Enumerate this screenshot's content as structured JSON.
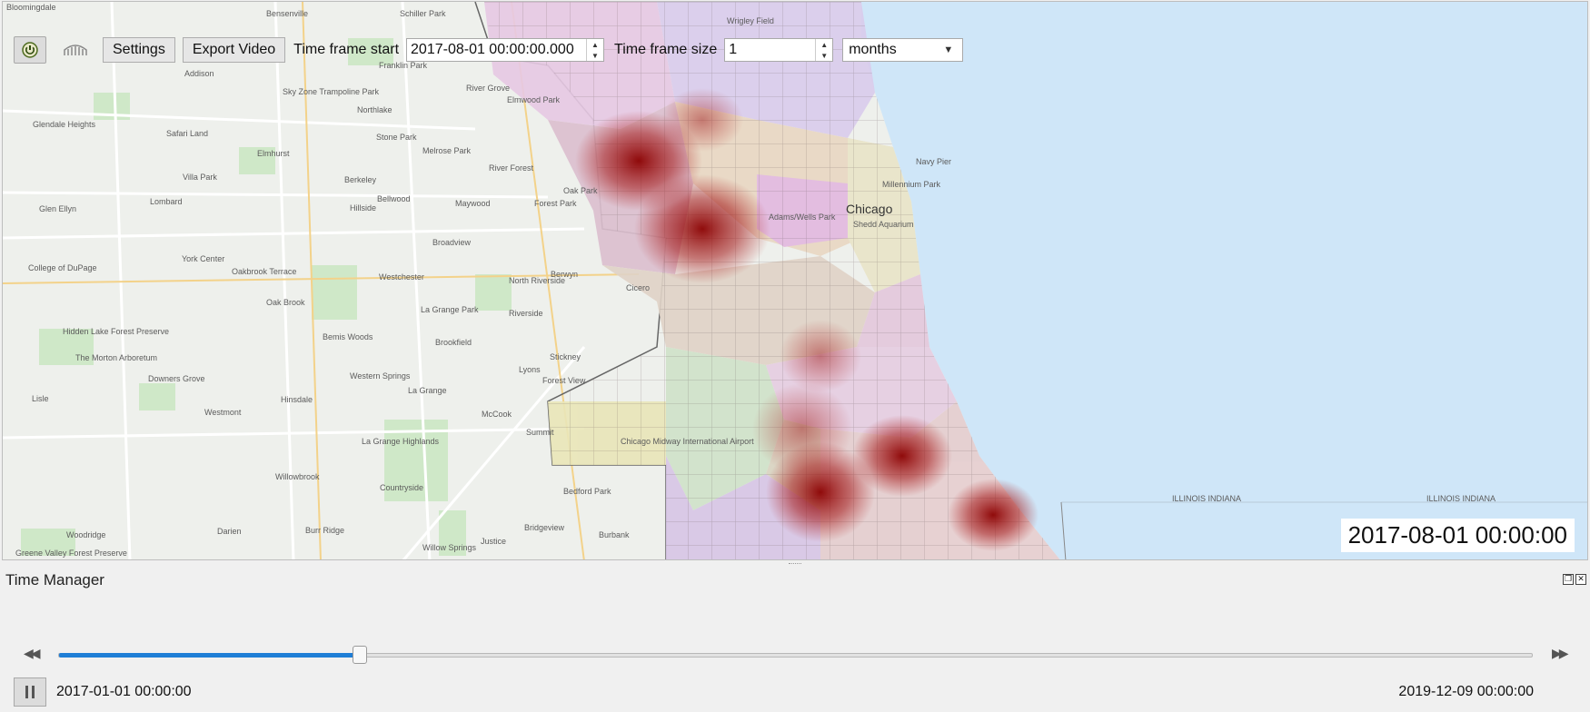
{
  "map": {
    "current_time": "2017-08-01 00:00:00",
    "place_labels": [
      {
        "text": "Bloomingdale"
      },
      {
        "text": "Bensenville"
      },
      {
        "text": "Schiller Park"
      },
      {
        "text": "Franklin Park"
      },
      {
        "text": "Addison"
      },
      {
        "text": "Sky Zone Trampoline Park"
      },
      {
        "text": "River Grove"
      },
      {
        "text": "Elmwood Park"
      },
      {
        "text": "Northlake"
      },
      {
        "text": "Glendale Heights"
      },
      {
        "text": "Safari Land"
      },
      {
        "text": "Stone Park"
      },
      {
        "text": "Melrose Park"
      },
      {
        "text": "Elmhurst"
      },
      {
        "text": "River Forest"
      },
      {
        "text": "Villa Park"
      },
      {
        "text": "Berkeley"
      },
      {
        "text": "Bellwood"
      },
      {
        "text": "Oak Park"
      },
      {
        "text": "Glen Ellyn"
      },
      {
        "text": "Lombard"
      },
      {
        "text": "Hillside"
      },
      {
        "text": "Maywood"
      },
      {
        "text": "Forest Park"
      },
      {
        "text": "Broadview"
      },
      {
        "text": "College of DuPage"
      },
      {
        "text": "York Center"
      },
      {
        "text": "Oakbrook Terrace"
      },
      {
        "text": "Westchester"
      },
      {
        "text": "Berwyn"
      },
      {
        "text": "Cicero"
      },
      {
        "text": "North Riverside"
      },
      {
        "text": "Oak Brook"
      },
      {
        "text": "La Grange Park"
      },
      {
        "text": "Riverside"
      },
      {
        "text": "Hidden Lake Forest Preserve"
      },
      {
        "text": "Bemis Woods"
      },
      {
        "text": "Brookfield"
      },
      {
        "text": "The Morton Arboretum"
      },
      {
        "text": "Downers Grove"
      },
      {
        "text": "Western Springs"
      },
      {
        "text": "Stickney"
      },
      {
        "text": "Lyons"
      },
      {
        "text": "Forest View"
      },
      {
        "text": "Lisle"
      },
      {
        "text": "Hinsdale"
      },
      {
        "text": "La Grange"
      },
      {
        "text": "McCook"
      },
      {
        "text": "Westmont"
      },
      {
        "text": "Summit"
      },
      {
        "text": "La Grange Highlands"
      },
      {
        "text": "Chicago Midway International Airport"
      },
      {
        "text": "Willowbrook"
      },
      {
        "text": "Countryside"
      },
      {
        "text": "Bedford Park"
      },
      {
        "text": "Woodridge"
      },
      {
        "text": "Darien"
      },
      {
        "text": "Burr Ridge"
      },
      {
        "text": "Bridgeview"
      },
      {
        "text": "Burbank"
      },
      {
        "text": "Justice"
      },
      {
        "text": "Willow Springs"
      },
      {
        "text": "Greene Valley Forest Preserve"
      },
      {
        "text": "Wrigley Field"
      },
      {
        "text": "Chicago"
      },
      {
        "text": "Navy Pier"
      },
      {
        "text": "Millennium Park"
      },
      {
        "text": "Shedd Aquarium"
      },
      {
        "text": "Adams/Wells Park"
      },
      {
        "text": "ILLINOIS INDIANA"
      },
      {
        "text": "ILLINOIS INDIANA"
      }
    ]
  },
  "panel": {
    "title": "Time Manager",
    "power_icon": "power-icon",
    "bridge_icon": "bridge-icon",
    "settings_label": "Settings",
    "export_label": "Export Video",
    "time_frame_start_label": "Time frame start",
    "time_frame_start_value": "2017-08-01 00:00:00.000",
    "time_frame_size_label": "Time frame size",
    "time_frame_size_value": "1",
    "unit_value": "months",
    "range_start": "2017-01-01 00:00:00",
    "range_end": "2019-12-09 00:00:00",
    "slider_progress": 0.2
  },
  "colors": {
    "accent": "#1f7ed6",
    "water": "#cfe6f8",
    "heat": "#8b0000"
  }
}
